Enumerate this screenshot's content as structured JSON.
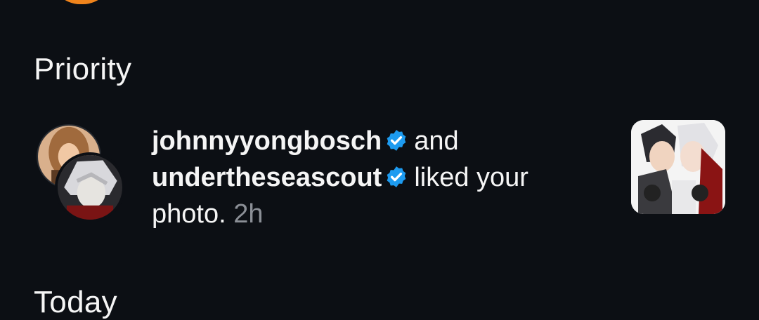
{
  "sections": {
    "priority_title": "Priority",
    "today_title": "Today"
  },
  "notification": {
    "user1": "johnnyyongbosch",
    "connector": "and",
    "user2": "undertheseascout",
    "action": "liked your photo.",
    "time": "2h"
  },
  "colors": {
    "background": "#0c0f14",
    "verified": "#1d9bf0",
    "accent_ring": "#f0841c",
    "muted_text": "#8b8f96"
  },
  "icons": {
    "verified": "verified-badge-icon"
  }
}
